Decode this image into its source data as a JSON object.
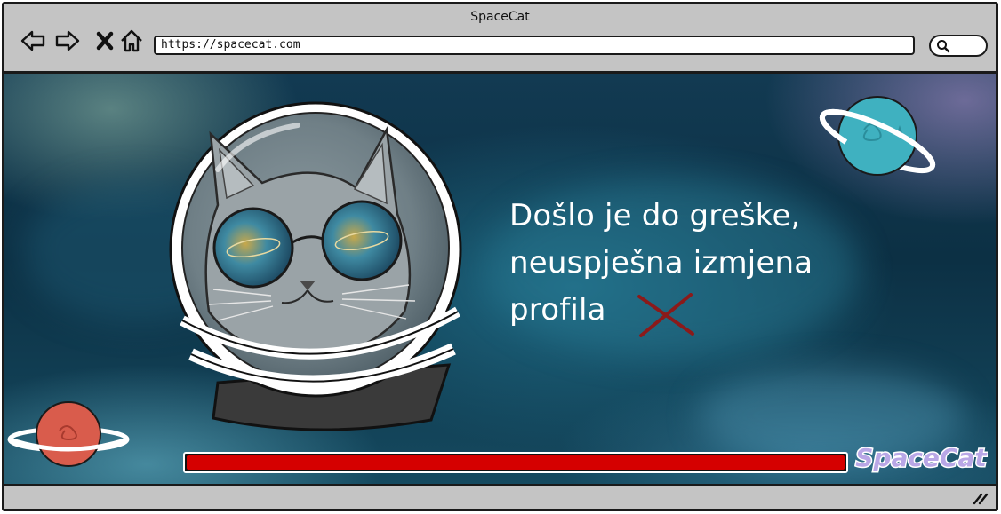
{
  "window": {
    "title": "SpaceCat"
  },
  "toolbar": {
    "back_icon": "arrow-left-icon",
    "forward_icon": "arrow-right-icon",
    "stop_icon": "close-icon",
    "home_icon": "home-icon",
    "url": "https://spacecat.com",
    "search_icon": "search-icon"
  },
  "content": {
    "message_lines": [
      "Došlo je do greške,",
      "neuspješna izmjena",
      "profila"
    ],
    "error_icon": "cross-icon",
    "error_color": "#8b1a1a",
    "progress": {
      "fraction": 1.0,
      "color": "#d50000"
    },
    "logo_text": "SpaceCat"
  },
  "colors": {
    "chrome": "#c4c4c4",
    "border": "#1a1a1a",
    "space_bg": "#0c3044",
    "text": "#ffffff"
  }
}
